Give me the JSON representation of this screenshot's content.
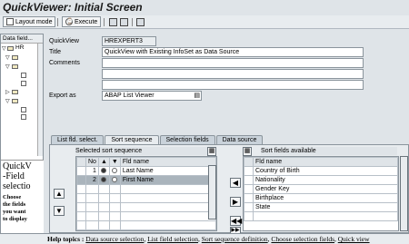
{
  "window": {
    "title": "QuickViewer: Initial Screen"
  },
  "toolbar": {
    "layout_mode": "Layout mode",
    "execute": "Execute"
  },
  "left_pane": {
    "header": "Data field...",
    "tree_item_hr": "HR",
    "info_title": "QuickV",
    "info_line2": "-Field",
    "info_line3": "selectio",
    "info_small": [
      "Choose",
      "the fields",
      "you want",
      "to display"
    ]
  },
  "form": {
    "quickview_label": "QuickView",
    "quickview_value": "HREXPERT3",
    "title_label": "Title",
    "title_value": "QuickView with Existing InfoSet as Data Source",
    "comments_label": "Comments",
    "export_label": "Export as",
    "export_value": "ABAP List Viewer"
  },
  "tabs": [
    {
      "label": "List fld. select."
    },
    {
      "label": "Sort sequence"
    },
    {
      "label": "Selection fields"
    },
    {
      "label": "Data source"
    }
  ],
  "selected_sort": {
    "title": "Selected sort sequence",
    "columns": [
      "No",
      "",
      "",
      "Fld name"
    ],
    "rows": [
      {
        "no": "1",
        "name": "Last Name",
        "asc": true
      },
      {
        "no": "2",
        "name": "First Name",
        "asc": true
      }
    ]
  },
  "available_sort": {
    "title": "Sort fields available",
    "column": "Fld name",
    "rows": [
      "Country of Birth",
      "Nationality",
      "Gender Key",
      "Birthplace",
      "State"
    ]
  },
  "status": {
    "prefix": "Help topics :",
    "links": [
      "Data source selection",
      "List field selection",
      "Sort sequence definition",
      "Choose selection fields",
      "Quick view"
    ]
  }
}
